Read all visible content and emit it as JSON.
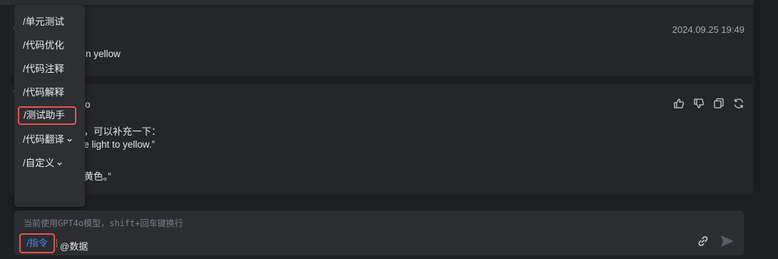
{
  "messages": {
    "first": {
      "timestamp": "2024.09.25 19:49",
      "text": "in yellow"
    },
    "second": {
      "sender_fragment": "o",
      "line1": "查，可以补充一下：",
      "line2": "me light to yellow.”",
      "line3": "的黄色。”"
    }
  },
  "command_menu": {
    "items": [
      {
        "label": "/单元测试"
      },
      {
        "label": "/代码优化"
      },
      {
        "label": "/代码注释"
      },
      {
        "label": "/代码解释"
      },
      {
        "label": "/测试助手"
      },
      {
        "label": "/代码翻译"
      },
      {
        "label": "/自定义"
      }
    ]
  },
  "input": {
    "placeholder": "当前使用GPT4o模型，shift+回车键换行",
    "command_label": "/指令",
    "data_label": "@数据"
  },
  "colors": {
    "accent": "#4a8cf2",
    "highlight_border": "#e5534b"
  },
  "icons": [
    "thumbs-up-icon",
    "thumbs-down-icon",
    "copy-icon",
    "refresh-icon",
    "link-icon",
    "send-icon",
    "chevron-down-icon"
  ]
}
